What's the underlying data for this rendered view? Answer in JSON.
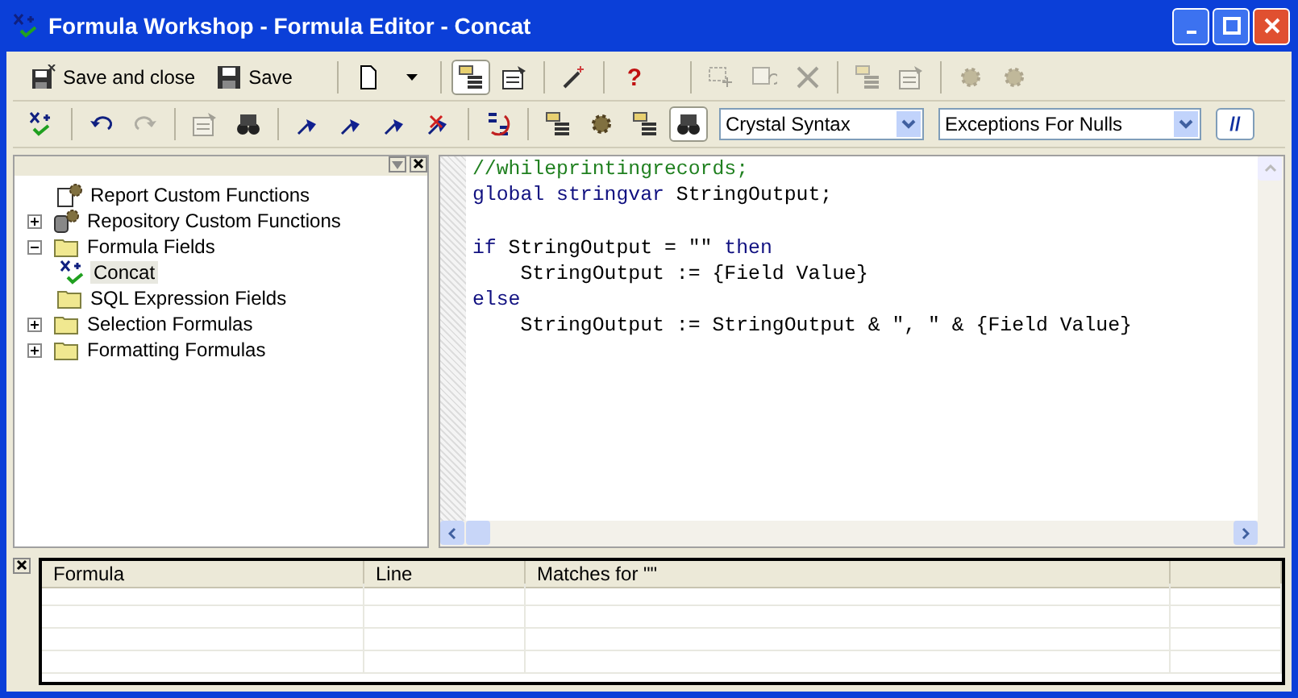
{
  "window": {
    "title": "Formula Workshop - Formula Editor - Concat"
  },
  "toolbar_1": {
    "buttons": [
      {
        "kind": "save-close",
        "label": "Save and close"
      },
      {
        "kind": "save",
        "label": "Save"
      }
    ],
    "tools": [
      {
        "kind": "sep"
      },
      {
        "kind": "page",
        "disabled": false,
        "pressed": false
      },
      {
        "kind": "caret",
        "disabled": false,
        "pressed": false
      },
      {
        "kind": "sep"
      },
      {
        "kind": "tree",
        "disabled": false,
        "pressed": true
      },
      {
        "kind": "props",
        "disabled": false,
        "pressed": false
      },
      {
        "kind": "sep"
      },
      {
        "kind": "wand",
        "disabled": false,
        "pressed": false
      },
      {
        "kind": "sep"
      },
      {
        "kind": "help",
        "label": "?",
        "disabled": false,
        "pressed": false
      },
      {
        "kind": "gap"
      },
      {
        "kind": "sep"
      },
      {
        "kind": "newitem",
        "disabled": true,
        "pressed": false
      },
      {
        "kind": "rename",
        "disabled": true,
        "pressed": false
      },
      {
        "kind": "delete",
        "disabled": true,
        "pressed": false
      },
      {
        "kind": "sep"
      },
      {
        "kind": "tree",
        "disabled": true,
        "pressed": false
      },
      {
        "kind": "props",
        "disabled": true,
        "pressed": false
      },
      {
        "kind": "sep"
      },
      {
        "kind": "gear",
        "disabled": true,
        "pressed": false
      },
      {
        "kind": "gear",
        "disabled": true,
        "pressed": false
      }
    ]
  },
  "toolbar_2": {
    "tools": [
      {
        "kind": "check"
      },
      {
        "kind": "sep"
      },
      {
        "kind": "undo",
        "disabled": false,
        "pressed": false
      },
      {
        "kind": "redo",
        "disabled": true,
        "pressed": false
      },
      {
        "kind": "sep"
      },
      {
        "kind": "props",
        "disabled": true,
        "pressed": false
      },
      {
        "kind": "find",
        "disabled": false,
        "pressed": false
      },
      {
        "kind": "sep"
      },
      {
        "kind": "flag",
        "disabled": false,
        "pressed": false
      },
      {
        "kind": "flag",
        "disabled": false,
        "pressed": false
      },
      {
        "kind": "flag",
        "disabled": false,
        "pressed": false
      },
      {
        "kind": "flagx",
        "disabled": false,
        "pressed": false
      },
      {
        "kind": "sep"
      },
      {
        "kind": "sort",
        "disabled": false,
        "pressed": false
      },
      {
        "kind": "sep"
      },
      {
        "kind": "tree",
        "disabled": false,
        "pressed": false
      },
      {
        "kind": "gear",
        "disabled": false,
        "pressed": false
      },
      {
        "kind": "tree",
        "disabled": false,
        "pressed": false
      },
      {
        "kind": "find",
        "disabled": false,
        "pressed": true
      }
    ],
    "syntax": "Crystal Syntax",
    "nulls": "Exceptions For Nulls",
    "comment_button": "//"
  },
  "tree": [
    {
      "kind": "gear-doc",
      "label": "Report Custom Functions",
      "selected": false
    },
    {
      "kind": "gear-db",
      "label": "Repository Custom Functions",
      "expanded": false,
      "selected": false
    },
    {
      "kind": "folder",
      "label": "Formula Fields",
      "expanded": true,
      "selected": false,
      "children": [
        {
          "kind": "formula",
          "label": "Concat",
          "selected": true
        }
      ]
    },
    {
      "kind": "folder",
      "label": "SQL Expression Fields",
      "selected": false
    },
    {
      "kind": "folder",
      "label": "Selection Formulas",
      "expanded": false,
      "selected": false
    },
    {
      "kind": "folder",
      "label": "Formatting Formulas",
      "expanded": false,
      "selected": false
    }
  ],
  "editor": {
    "lines": [
      {
        "kind": "code",
        "segments": [
          {
            "kind": "comment",
            "text": "//whileprintingrecords;"
          }
        ]
      },
      {
        "kind": "code",
        "segments": [
          {
            "kind": "keyword",
            "text": "global stringvar"
          },
          {
            "kind": "plain",
            "text": " StringOutput;"
          }
        ]
      },
      {
        "kind": "blank"
      },
      {
        "kind": "code",
        "segments": [
          {
            "kind": "keyword",
            "text": "if"
          },
          {
            "kind": "plain",
            "text": " StringOutput = \"\" "
          },
          {
            "kind": "keyword",
            "text": "then"
          }
        ]
      },
      {
        "kind": "code",
        "segments": [
          {
            "kind": "plain",
            "text": "    StringOutput := {Field Value}"
          }
        ]
      },
      {
        "kind": "code",
        "segments": [
          {
            "kind": "keyword",
            "text": "else"
          }
        ]
      },
      {
        "kind": "code",
        "segments": [
          {
            "kind": "plain",
            "text": "    StringOutput := StringOutput & \", \" & {Field Value}"
          }
        ]
      }
    ]
  },
  "results": {
    "columns": [
      "Formula",
      "Line",
      "Matches for \"\""
    ]
  }
}
